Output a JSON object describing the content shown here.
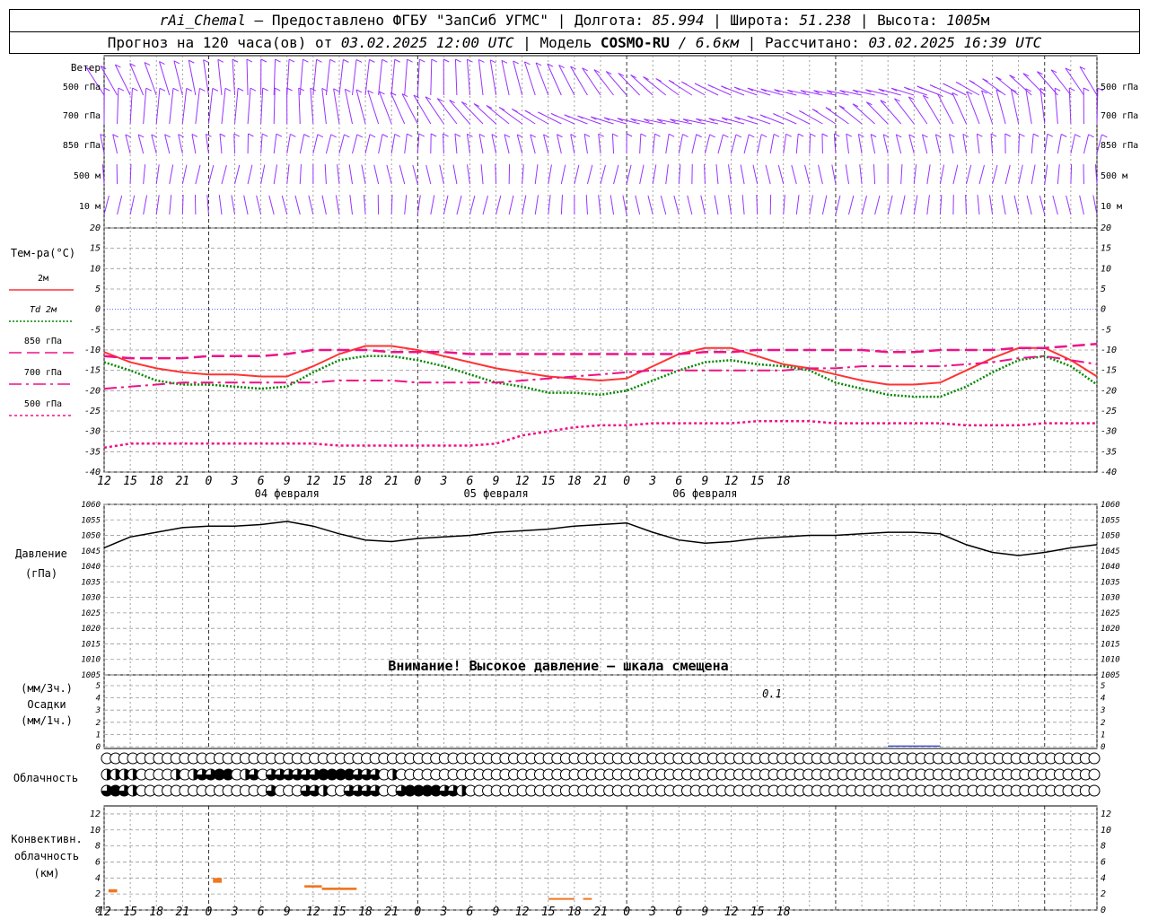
{
  "header": {
    "station": "rAi_Chemal",
    "provider": "— Предоставлено ФГБУ \"ЗапСиб УГМС\"",
    "lon_label": "Долгота:",
    "lon_value": "85.994",
    "lat_label": "Широта:",
    "lat_value": "51.238",
    "alt_label": "Высота:",
    "alt_value": "1005",
    "alt_unit": "м",
    "forecast_label": "Прогноз на 120 часа(ов) от",
    "forecast_start": "03.02.2025 12:00 UTC",
    "model_label": "Модель",
    "model_name": "COSMO-RU",
    "model_res": "/ 6.6км",
    "computed_label": "Рассчитано:",
    "computed_time": "03.02.2025 16:39 UTC"
  },
  "time_axis": {
    "hour_labels": [
      "12",
      "15",
      "18",
      "21",
      "0",
      "3",
      "6",
      "9",
      "12",
      "15",
      "18",
      "21",
      "0",
      "3",
      "6",
      "9",
      "12",
      "15",
      "18",
      "21",
      "0",
      "3",
      "6",
      "9",
      "12",
      "15",
      "18"
    ],
    "day_labels": [
      "04 февраля",
      "05 февраля",
      "06 февраля"
    ]
  },
  "wind_panel": {
    "title": "Ветер",
    "levels": [
      "500 гПа",
      "700 гПа",
      "850 гПа",
      "500 м",
      "10 м"
    ],
    "barb_color": "#9933ff"
  },
  "temp_panel": {
    "title": "Тем-ра(°C)",
    "ticks": [
      "20",
      "15",
      "10",
      "5",
      "0",
      "-5",
      "-10",
      "-15",
      "-20",
      "-25",
      "-30",
      "-35",
      "-40"
    ],
    "legend": [
      {
        "label": "2м",
        "color": "#ff3333",
        "style": "solid"
      },
      {
        "label": "Td 2м",
        "color": "#008800",
        "style": "dotted"
      },
      {
        "label": "850 гПа",
        "color": "#ee1188",
        "style": "dash"
      },
      {
        "label": "700 гПа",
        "color": "#ee1188",
        "style": "dashdot"
      },
      {
        "label": "500 гПа",
        "color": "#ee1188",
        "style": "dot"
      }
    ]
  },
  "pressure_panel": {
    "title": "Давление",
    "unit": "(гПа)",
    "ticks": [
      "1060",
      "1055",
      "1050",
      "1045",
      "1040",
      "1035",
      "1030",
      "1025",
      "1020",
      "1015",
      "1010",
      "1005"
    ],
    "warning": "Внимание! Высокое давление — шкала смещена"
  },
  "precip_panel": {
    "label_3h": "(мм/3ч.)",
    "title": "Осадки",
    "label_1h": "(мм/1ч.)",
    "ticks": [
      "5",
      "4",
      "3",
      "2",
      "1",
      "0"
    ],
    "annotation": "0.1"
  },
  "cloud_panel": {
    "title": "Облачность"
  },
  "convective_panel": {
    "title_1": "Конвективн.",
    "title_2": "облачность",
    "unit": "(км)",
    "ticks": [
      "12",
      "10",
      "8",
      "6",
      "4",
      "2",
      "0"
    ],
    "bar_color": "#ee7722"
  },
  "chart_data": {
    "type": "line",
    "x_hours_from_start": [
      0,
      3,
      6,
      9,
      12,
      15,
      18,
      21,
      24,
      27,
      30,
      33,
      36,
      39,
      42,
      45,
      48,
      51,
      54,
      57,
      60,
      63,
      66,
      69,
      72,
      75,
      78,
      81,
      84,
      87,
      90,
      93,
      96,
      99,
      102,
      105,
      108,
      111,
      114
    ],
    "temperature": {
      "ylim": [
        -40,
        20
      ],
      "series": [
        {
          "name": "2м",
          "values": [
            -10.5,
            -13,
            -14.5,
            -15.5,
            -16,
            -16,
            -16.5,
            -16.5,
            -14,
            -11,
            -9,
            -9,
            -10,
            -11.5,
            -13,
            -14.5,
            -15.5,
            -16.5,
            -17,
            -17.5,
            -17,
            -14,
            -11,
            -9.5,
            -9.5,
            -11.5,
            -13.5,
            -14.5,
            -16,
            -17.5,
            -18.5,
            -18.5,
            -18,
            -15,
            -12,
            -9.5,
            -9.5,
            -12.5,
            -16.5
          ]
        },
        {
          "name": "Td 2м",
          "values": [
            -13,
            -15,
            -17.5,
            -18.5,
            -18.5,
            -19,
            -19.5,
            -19,
            -15.5,
            -12.5,
            -11.5,
            -11.5,
            -12.5,
            -14,
            -16,
            -18,
            -19,
            -20.5,
            -20.5,
            -21,
            -20,
            -17.5,
            -15,
            -13,
            -12.5,
            -13.5,
            -14,
            -15,
            -18,
            -19.5,
            -21,
            -21.5,
            -21.5,
            -19,
            -15.5,
            -12.5,
            -11.5,
            -14,
            -18.5
          ]
        },
        {
          "name": "850 гПа",
          "values": [
            -11.5,
            -12,
            -12,
            -12,
            -11.5,
            -11.5,
            -11.5,
            -11,
            -10,
            -10,
            -10,
            -10.5,
            -10.5,
            -10.5,
            -11,
            -11,
            -11,
            -11,
            -11,
            -11,
            -11,
            -11,
            -11,
            -10.5,
            -10.5,
            -10,
            -10,
            -10,
            -10,
            -10,
            -10.5,
            -10.5,
            -10,
            -10,
            -10,
            -9.5,
            -9.5,
            -9,
            -8.5
          ]
        },
        {
          "name": "700 гПа",
          "values": [
            -19.5,
            -19,
            -18.5,
            -18,
            -18,
            -18,
            -18,
            -18,
            -18,
            -17.5,
            -17.5,
            -17.5,
            -18,
            -18,
            -18,
            -18,
            -17.5,
            -17,
            -16.5,
            -16,
            -15.5,
            -15,
            -15,
            -15,
            -15,
            -15,
            -15,
            -14.5,
            -14.5,
            -14,
            -14,
            -14,
            -14,
            -13.5,
            -13,
            -12,
            -11.5,
            -12.5,
            -13.5
          ]
        },
        {
          "name": "500 гПа",
          "values": [
            -34,
            -33,
            -33,
            -33,
            -33,
            -33,
            -33,
            -33,
            -33,
            -33.5,
            -33.5,
            -33.5,
            -33.5,
            -33.5,
            -33.5,
            -33,
            -31,
            -30,
            -29,
            -28.5,
            -28.5,
            -28,
            -28,
            -28,
            -28,
            -27.5,
            -27.5,
            -27.5,
            -28,
            -28,
            -28,
            -28,
            -28,
            -28.5,
            -28.5,
            -28.5,
            -28,
            -28,
            -28
          ]
        }
      ]
    },
    "pressure": {
      "ylim": [
        1005,
        1060
      ],
      "values": [
        1046,
        1049.5,
        1051,
        1052.5,
        1053,
        1053,
        1053.5,
        1054.5,
        1053,
        1050.5,
        1048.5,
        1048,
        1049,
        1049.5,
        1050,
        1051,
        1051.5,
        1052,
        1053,
        1053.5,
        1054,
        1051,
        1048.5,
        1047.5,
        1048,
        1049,
        1049.5,
        1050,
        1050,
        1050.5,
        1051,
        1051,
        1050.5,
        1047,
        1044.5,
        1043.5,
        1044.5,
        1046,
        1047
      ]
    },
    "precipitation": {
      "ylim": [
        0,
        5
      ],
      "bars": [
        {
          "x_from": 90,
          "x_to": 96,
          "value": 0.1
        }
      ]
    },
    "cloudiness_octas": {
      "high": [
        0,
        0,
        0,
        0,
        0,
        0,
        0,
        0,
        0,
        0,
        0,
        0,
        0,
        0,
        0,
        0,
        0,
        0,
        0,
        0,
        0,
        0,
        0,
        0,
        0,
        0,
        0,
        0,
        0,
        0,
        0,
        0,
        0,
        0,
        0,
        0,
        0,
        0,
        0,
        0,
        0,
        0,
        0,
        0,
        0,
        0,
        0,
        0,
        0,
        0,
        0,
        0,
        0,
        0,
        0,
        0,
        0,
        0,
        0,
        0,
        0,
        0,
        0,
        0,
        0,
        0,
        0,
        0,
        0,
        0,
        0,
        0,
        0,
        0,
        0,
        0,
        0,
        0,
        0,
        0,
        0,
        0,
        0,
        0,
        0,
        0,
        0,
        0,
        0,
        0,
        0,
        0,
        0,
        0,
        0,
        0,
        0,
        0,
        0,
        0,
        0,
        0,
        0,
        0,
        0,
        0,
        0,
        0,
        0,
        0,
        0,
        0,
        0,
        0,
        0
      ],
      "middle": [
        4,
        4,
        4,
        4,
        0,
        0,
        0,
        0,
        4,
        0,
        4,
        6,
        6,
        8,
        8,
        0,
        4,
        6,
        0,
        6,
        6,
        6,
        6,
        6,
        6,
        8,
        8,
        8,
        8,
        6,
        6,
        6,
        0,
        4,
        0,
        0,
        0,
        0,
        0,
        0,
        0,
        0,
        0,
        0,
        0,
        0,
        0,
        0,
        0,
        0,
        0,
        0,
        0,
        0,
        0,
        0,
        0,
        0,
        0,
        0,
        0,
        0,
        0,
        0,
        0,
        0,
        0,
        0,
        0,
        0,
        0,
        0,
        0,
        0,
        0,
        0,
        0,
        0,
        0,
        0,
        0,
        0,
        0,
        0,
        0,
        0,
        0,
        0,
        0,
        0,
        0,
        0,
        0,
        0,
        0,
        0,
        0,
        0,
        0,
        0,
        0,
        0,
        0,
        0,
        0,
        0,
        0,
        0,
        0,
        0,
        0,
        0,
        0,
        0,
        0
      ],
      "low": [
        6,
        8,
        6,
        4,
        0,
        0,
        0,
        0,
        0,
        0,
        0,
        0,
        0,
        0,
        0,
        0,
        0,
        0,
        0,
        6,
        0,
        0,
        0,
        6,
        6,
        4,
        0,
        0,
        6,
        6,
        6,
        6,
        0,
        0,
        6,
        8,
        8,
        8,
        8,
        6,
        6,
        4,
        0,
        0,
        0,
        0,
        0,
        0,
        0,
        0,
        0,
        0,
        0,
        0,
        0,
        0,
        0,
        0,
        0,
        0,
        0,
        0,
        0,
        0,
        0,
        0,
        0,
        0,
        0,
        0,
        0,
        0,
        0,
        0,
        0,
        0,
        0,
        0,
        0,
        0,
        0,
        0,
        0,
        0,
        0,
        0,
        0,
        0,
        0,
        0,
        0,
        0,
        0,
        0,
        0,
        0,
        0,
        0,
        0,
        0,
        0,
        0,
        0,
        0,
        0,
        0,
        0,
        0,
        0,
        0,
        0,
        0,
        0,
        0,
        0
      ]
    },
    "convective_cloud_km": {
      "ylim": [
        0,
        13
      ],
      "bars": [
        {
          "x_from": 0.5,
          "x_to": 1.5,
          "bottom": 2.2,
          "top": 2.6
        },
        {
          "x_from": 12.5,
          "x_to": 13.5,
          "bottom": 3.4,
          "top": 4.0
        },
        {
          "x_from": 23,
          "x_to": 25,
          "bottom": 2.8,
          "top": 3.1
        },
        {
          "x_from": 25,
          "x_to": 29,
          "bottom": 2.5,
          "top": 2.8
        },
        {
          "x_from": 51,
          "x_to": 54,
          "bottom": 1.3,
          "top": 1.5
        },
        {
          "x_from": 55,
          "x_to": 56,
          "bottom": 1.4,
          "top": 1.5
        }
      ]
    }
  }
}
